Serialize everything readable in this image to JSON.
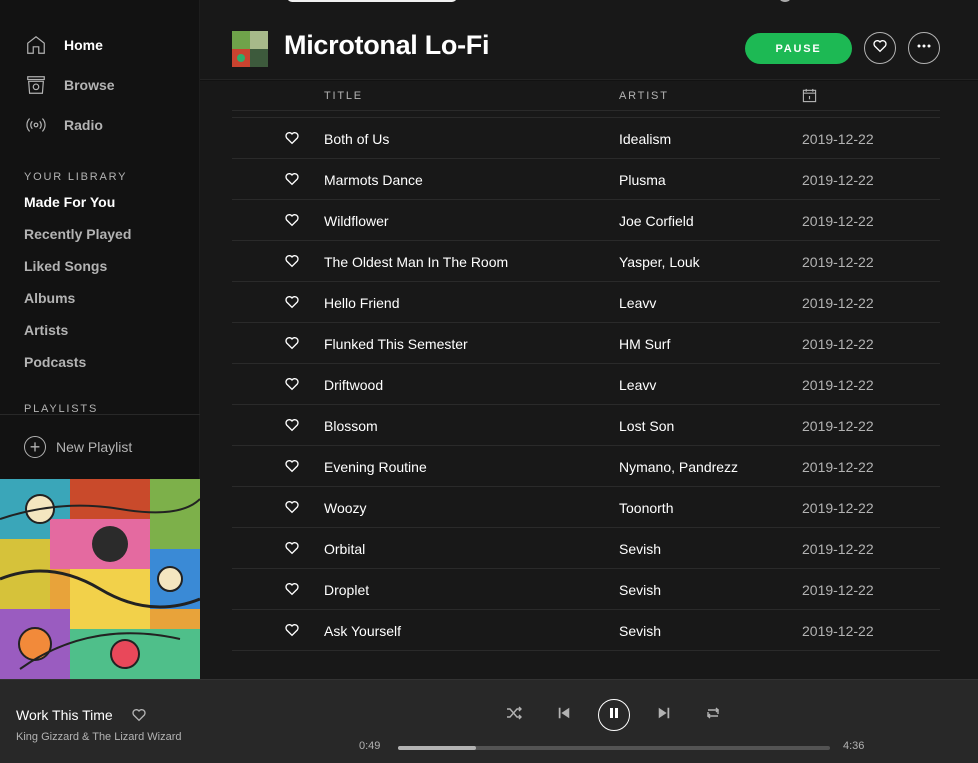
{
  "sidebar": {
    "nav": [
      {
        "label": "Home",
        "icon": "home-icon"
      },
      {
        "label": "Browse",
        "icon": "browse-icon"
      },
      {
        "label": "Radio",
        "icon": "radio-icon"
      }
    ],
    "library_heading": "YOUR LIBRARY",
    "library": [
      "Made For You",
      "Recently Played",
      "Liked Songs",
      "Albums",
      "Artists",
      "Podcasts"
    ],
    "playlists_heading": "PLAYLISTS",
    "new_playlist": "New Playlist"
  },
  "header": {
    "title": "Microtonal Lo-Fi",
    "pause_label": "PAUSE"
  },
  "tracklist": {
    "columns": {
      "title": "TITLE",
      "artist": "ARTIST",
      "date_icon": "calendar-icon"
    },
    "rows": [
      {
        "title": "Both of Us",
        "artist": "Idealism",
        "date": "2019-12-22"
      },
      {
        "title": "Marmots Dance",
        "artist": "Plusma",
        "date": "2019-12-22"
      },
      {
        "title": "Wildflower",
        "artist": "Joe Corfield",
        "date": "2019-12-22"
      },
      {
        "title": "The Oldest Man In The Room",
        "artist": "Yasper, Louk",
        "date": "2019-12-22"
      },
      {
        "title": "Hello Friend",
        "artist": "Leavv",
        "date": "2019-12-22"
      },
      {
        "title": "Flunked This Semester",
        "artist": "HM Surf",
        "date": "2019-12-22"
      },
      {
        "title": "Driftwood",
        "artist": "Leavv",
        "date": "2019-12-22"
      },
      {
        "title": "Blossom",
        "artist": "Lost Son",
        "date": "2019-12-22"
      },
      {
        "title": "Evening Routine",
        "artist": "Nymano, Pandrezz",
        "date": "2019-12-22"
      },
      {
        "title": "Woozy",
        "artist": "Toonorth",
        "date": "2019-12-22"
      },
      {
        "title": "Orbital",
        "artist": "Sevish",
        "date": "2019-12-22"
      },
      {
        "title": "Droplet",
        "artist": "Sevish",
        "date": "2019-12-22"
      },
      {
        "title": "Ask Yourself",
        "artist": "Sevish",
        "date": "2019-12-22"
      }
    ]
  },
  "player": {
    "track_title": "Work This Time",
    "track_artist": "King Gizzard & The Lizard Wizard",
    "elapsed": "0:49",
    "duration": "4:36",
    "progress_percent": 18,
    "state": "playing"
  },
  "colors": {
    "accent": "#1db954",
    "background": "#181818",
    "sidebar": "#121212",
    "player": "#282828",
    "text_muted": "#b3b3b3"
  }
}
